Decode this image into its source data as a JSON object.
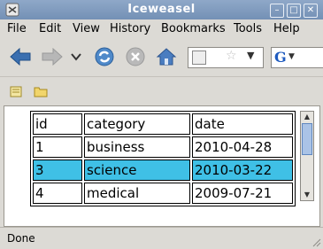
{
  "window": {
    "title": "Iceweasel"
  },
  "menu": {
    "items": [
      "File",
      "Edit",
      "View",
      "History",
      "Bookmarks",
      "Tools",
      "Help"
    ]
  },
  "toolbar": {
    "icons": [
      "back-icon",
      "forward-icon",
      "dropdown-icon",
      "reload-icon",
      "stop-icon",
      "home-icon"
    ]
  },
  "urlbar": {
    "value": ""
  },
  "search": {
    "engine_glyph": "G"
  },
  "table": {
    "headers": [
      "id",
      "category",
      "date"
    ],
    "rows": [
      [
        "1",
        "business",
        "2010-04-28"
      ],
      [
        "3",
        "science",
        "2010-03-22"
      ],
      [
        "4",
        "medical",
        "2009-07-21"
      ]
    ],
    "selected_row": 1
  },
  "status": {
    "text": "Done"
  },
  "colors": {
    "titlebar": "#7f9cc1",
    "selection": "#3fc0e6",
    "chrome": "#dcdad5"
  }
}
